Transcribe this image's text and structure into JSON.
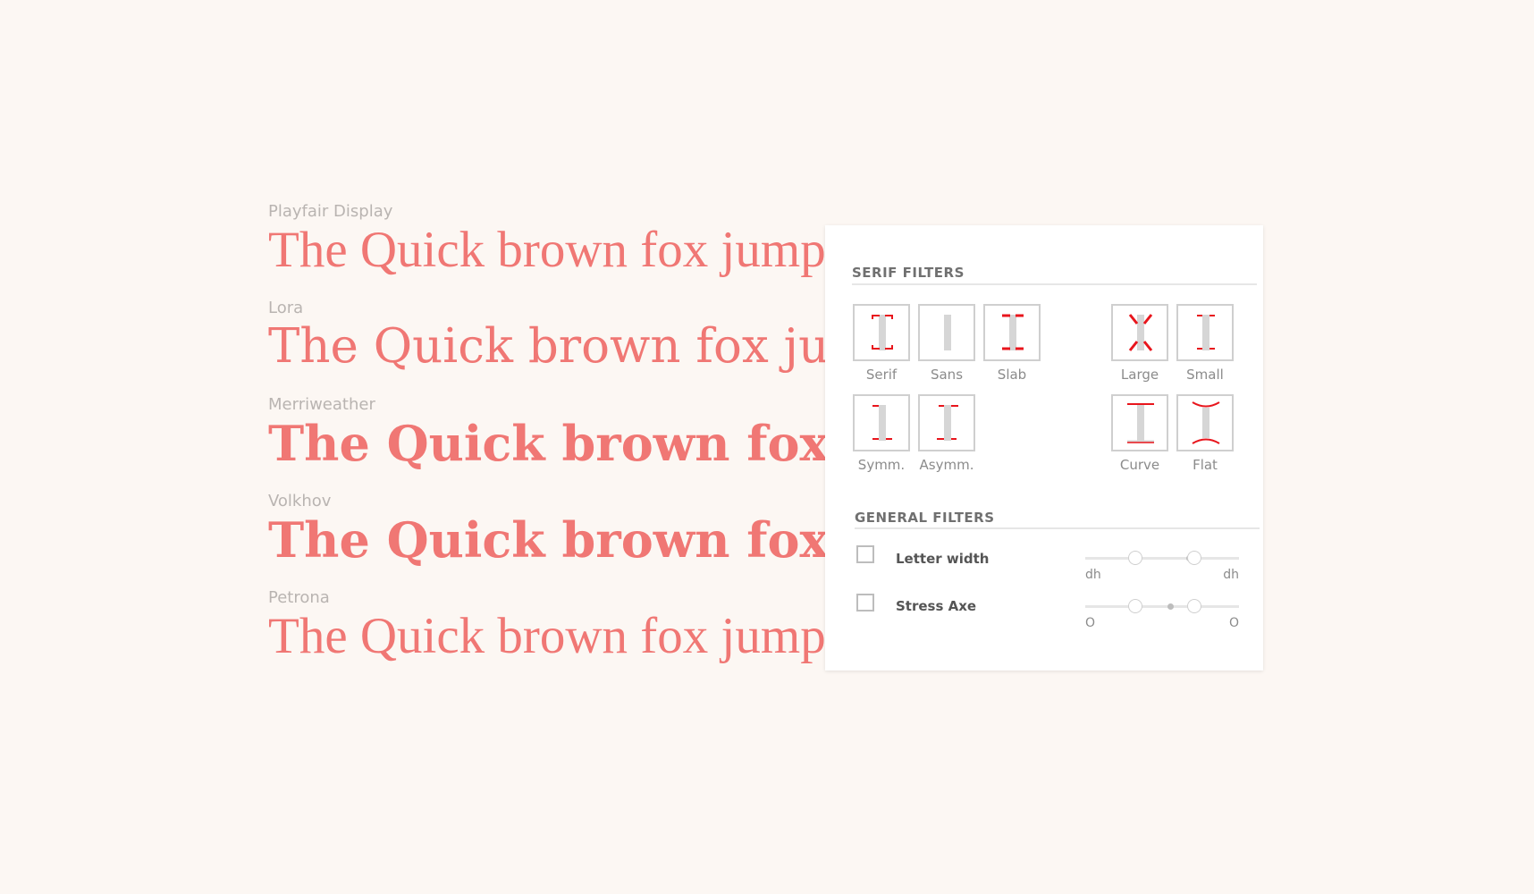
{
  "specimens": [
    {
      "font": "Playfair Display",
      "sample": "The Quick brown fox jumped over the lazy dog"
    },
    {
      "font": "Lora",
      "sample": "The Quick brown fox jumped over the lazy dog"
    },
    {
      "font": "Merriweather",
      "sample": "The Quick brown fox jumped over the lazy dog"
    },
    {
      "font": "Volkhov",
      "sample": "The Quick brown fox jumped over the lazy dog"
    },
    {
      "font": "Petrona",
      "sample": "The Quick brown fox jumped over the lazy dog"
    }
  ],
  "serif_filters": {
    "title": "SERIF FILTERS",
    "tiles": {
      "serif": "Serif",
      "sans": "Sans",
      "slab": "Slab",
      "large": "Large",
      "small": "Small",
      "symm": "Symm.",
      "asymm": "Asymm.",
      "curve": "Curve",
      "flat": "Flat"
    }
  },
  "general_filters": {
    "title": "GENERAL FILTERS",
    "letter_width": {
      "label": "Letter width",
      "min_label": "dh",
      "max_label": "dh"
    },
    "stress_axe": {
      "label": "Stress Axe",
      "min_label": "O",
      "max_label": "O"
    }
  },
  "colors": {
    "accent": "#f07774",
    "background": "#fcf7f3",
    "tile_marker": "#e8151c"
  }
}
